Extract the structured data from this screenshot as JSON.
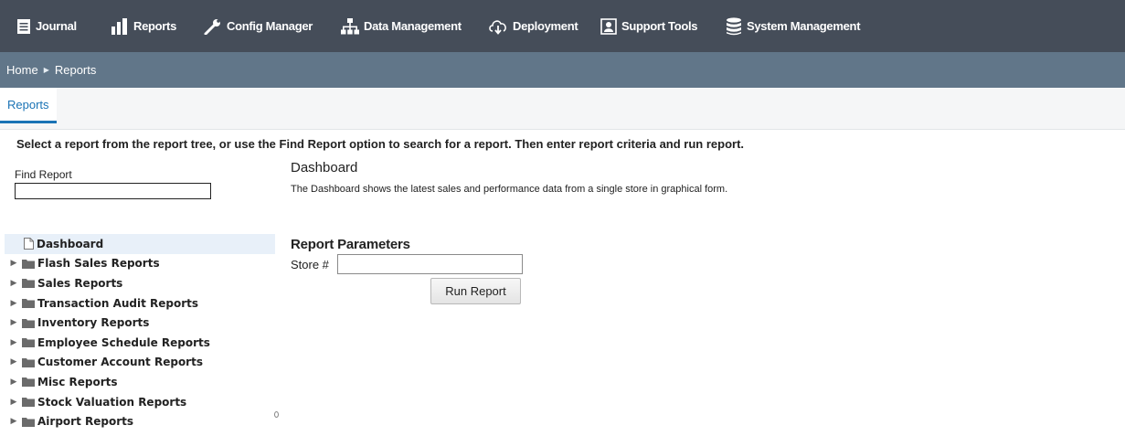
{
  "topnav": {
    "items": [
      {
        "label": "Journal",
        "icon": "journal-icon"
      },
      {
        "label": "Reports",
        "icon": "bar-chart-icon"
      },
      {
        "label": "Config Manager",
        "icon": "wrench-icon"
      },
      {
        "label": "Data Management",
        "icon": "hierarchy-icon"
      },
      {
        "label": "Deployment",
        "icon": "download-cloud-icon"
      },
      {
        "label": "Support Tools",
        "icon": "user-screen-icon"
      },
      {
        "label": "System Management",
        "icon": "database-icon"
      }
    ]
  },
  "breadcrumb": {
    "home": "Home",
    "current": "Reports"
  },
  "tabs": [
    {
      "label": "Reports",
      "active": true
    }
  ],
  "instruction": "Select a report from the report tree, or use the Find Report option to search for a report. Then enter report criteria and run report.",
  "find_report": {
    "label": "Find Report",
    "value": ""
  },
  "tree": {
    "items": [
      {
        "label": "Dashboard",
        "type": "document",
        "selected": true
      },
      {
        "label": "Flash Sales Reports",
        "type": "folder"
      },
      {
        "label": "Sales Reports",
        "type": "folder"
      },
      {
        "label": "Transaction Audit Reports",
        "type": "folder"
      },
      {
        "label": "Inventory Reports",
        "type": "folder"
      },
      {
        "label": "Employee Schedule Reports",
        "type": "folder"
      },
      {
        "label": "Customer Account Reports",
        "type": "folder"
      },
      {
        "label": "Misc Reports",
        "type": "folder"
      },
      {
        "label": "Stock Valuation Reports",
        "type": "folder"
      },
      {
        "label": "Airport Reports",
        "type": "folder"
      }
    ]
  },
  "report": {
    "title": "Dashboard",
    "description": "The Dashboard shows the latest sales and performance data from a single store in graphical form."
  },
  "parameters": {
    "title": "Report Parameters",
    "store_label": "Store #",
    "store_value": "",
    "run_label": "Run Report"
  },
  "colors": {
    "topnav_bg": "#454d59",
    "breadcrumb_bg": "#617689",
    "accent": "#1a73b5"
  }
}
